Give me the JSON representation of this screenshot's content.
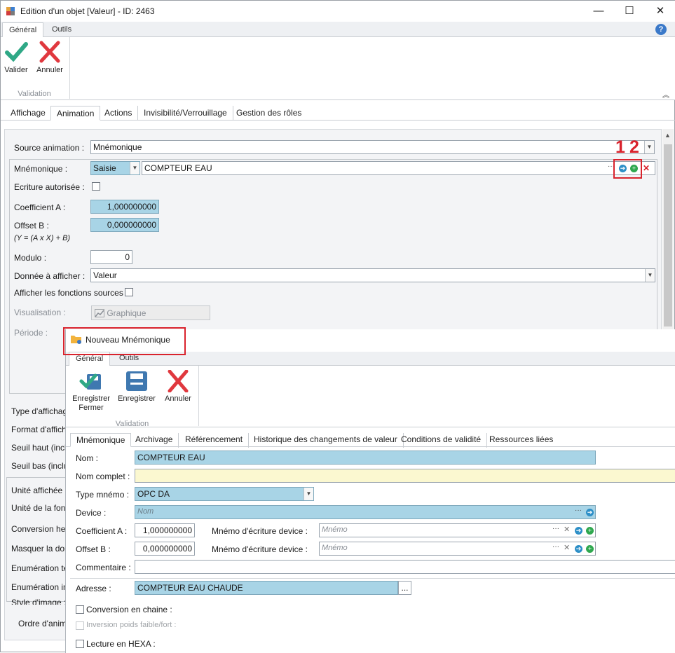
{
  "window": {
    "title": "Edition d'un objet [Valeur] - ID: 2463",
    "minimize": "—",
    "maximize": "☐",
    "close": "✕"
  },
  "ribbon": {
    "tabs": [
      "Général",
      "Outils"
    ],
    "validate_label": "Valider",
    "cancel_label": "Annuler",
    "group_label": "Validation"
  },
  "tabs": [
    "Affichage",
    "Animation",
    "Actions",
    "Invisibilité/Verrouillage",
    "Gestion des rôles"
  ],
  "animation": {
    "source_label": "Source animation :",
    "source_value": "Mnémonique",
    "mnemo_label": "Mnémonique :",
    "mnemo_mode": "Saisie",
    "mnemo_value": "COMPTEUR EAU",
    "mnemo_ellipsis": "···",
    "write_label": "Ecriture autorisée :",
    "coefA_label": "Coefficient A :",
    "coefA_value": "1,000000000",
    "offsetB_label": "Offset B :",
    "offsetB_value": "0,000000000",
    "formula": "(Y = (A x X) + B)",
    "modulo_label": "Modulo :",
    "modulo_value": "0",
    "data_label": "Donnée à afficher :",
    "data_value": "Valeur",
    "sources_label": "Afficher les fonctions sources :",
    "vis_label": "Visualisation :",
    "vis_button": "Graphique",
    "period_label": "Période :"
  },
  "left_labels": [
    "Type d'affichag",
    "Format d'afficha",
    "Seuil haut (inclu",
    "Seuil bas (inclu",
    "Unité affichée :",
    "Unité de la fonc",
    "Conversion hex",
    "Masquer la don",
    "Enumération tex",
    "Enumération im",
    "Style d'image :",
    "Ordre d'anim"
  ],
  "annotations": {
    "n1": "1",
    "n2": "2"
  },
  "dialog": {
    "title": "Nouveau Mnémonique",
    "tabs": [
      "Général",
      "Outils"
    ],
    "save_close_label": "Enregistrer Fermer",
    "save_label": "Enregistrer",
    "cancel_label": "Annuler",
    "group_label": "Validation",
    "subtabs": [
      "Mnémonique",
      "Archivage",
      "Référencement",
      "Historique des changements de valeur",
      "Conditions de validité",
      "Ressources liées"
    ],
    "nom_label": "Nom :",
    "nom_value": "COMPTEUR EAU",
    "nom_complet_label": "Nom complet :",
    "type_label": "Type mnémo :",
    "type_value": "OPC DA",
    "device_label": "Device :",
    "device_placeholder": "Nom",
    "coefA_label": "Coefficient A :",
    "coefA_value": "1,000000000",
    "offsetB_label": "Offset B :",
    "offsetB_value": "0,000000000",
    "mnemo_write_label": "Mnémo d'écriture device :",
    "mnemo_placeholder": "Mnémo",
    "comment_label": "Commentaire :",
    "address_label": "Adresse :",
    "address_value": "COMPTEUR EAU CHAUDE",
    "address_btn": "...",
    "conv_label": "Conversion en chaine :",
    "inversion_label": "Inversion poids faible/fort :",
    "hexa_label": "Lecture en HEXA :"
  }
}
